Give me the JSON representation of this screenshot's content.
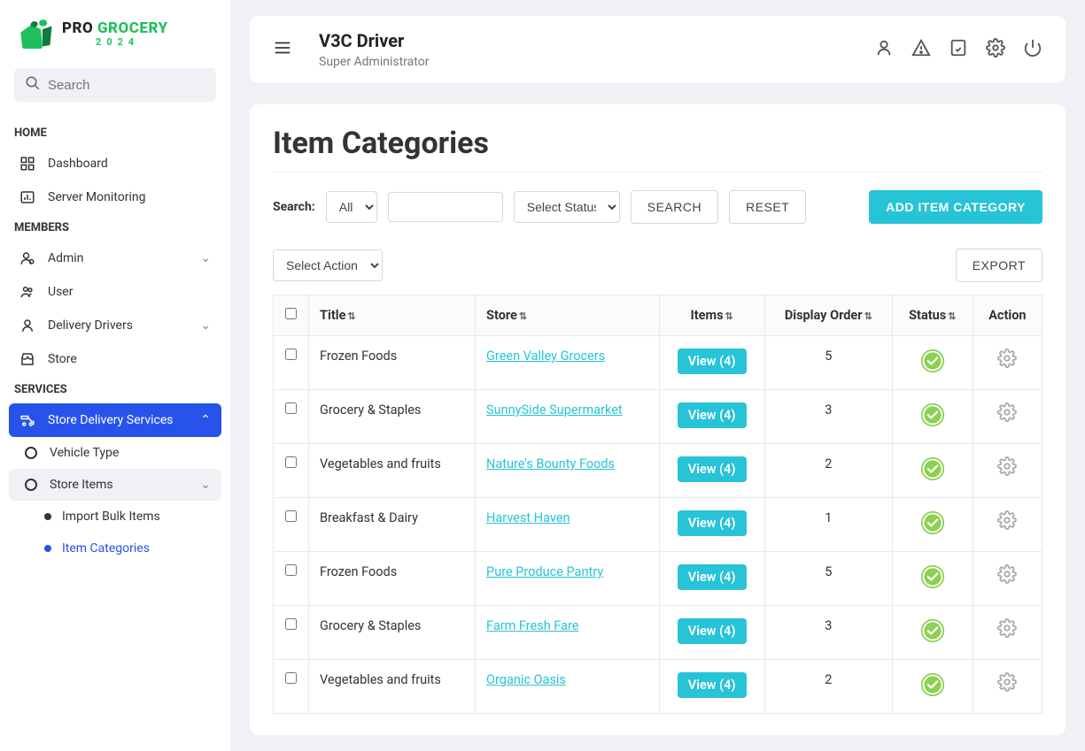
{
  "brand": {
    "pro": "PRO",
    "grocery": "GROCERY",
    "year": "2024"
  },
  "sidebar": {
    "search_placeholder": "Search",
    "sections": {
      "home": "HOME",
      "members": "MEMBERS",
      "services": "SERVICES"
    },
    "home_items": [
      {
        "label": "Dashboard"
      },
      {
        "label": "Server Monitoring"
      }
    ],
    "member_items": [
      {
        "label": "Admin",
        "expandable": true
      },
      {
        "label": "User"
      },
      {
        "label": "Delivery Drivers",
        "expandable": true
      },
      {
        "label": "Store"
      }
    ],
    "services_items": [
      {
        "label": "Store Delivery Services",
        "active": true,
        "expandable": true
      }
    ],
    "delivery_sub": [
      {
        "label": "Vehicle Type"
      },
      {
        "label": "Store Items",
        "sub_active": true,
        "expandable": true
      }
    ],
    "store_items_sub": [
      {
        "label": "Import Bulk Items"
      },
      {
        "label": "Item Categories",
        "current": true
      }
    ]
  },
  "header": {
    "user_name": "V3C Driver",
    "user_role": "Super Administrator"
  },
  "page": {
    "title": "Item Categories",
    "search_label": "Search:",
    "filter_all": "All",
    "select_status": "Select Status",
    "search_btn": "SEARCH",
    "reset_btn": "RESET",
    "add_btn": "ADD ITEM CATEGORY",
    "select_action": "Select Action",
    "export_btn": "EXPORT",
    "columns": {
      "title": "Title",
      "store": "Store",
      "items": "Items",
      "display_order": "Display Order",
      "status": "Status",
      "action": "Action"
    },
    "rows": [
      {
        "title": "Frozen Foods",
        "store": "Green Valley Grocers",
        "items": "View (4)",
        "display_order": "5"
      },
      {
        "title": "Grocery & Staples",
        "store": "SunnySide Supermarket",
        "items": "View (4)",
        "display_order": "3"
      },
      {
        "title": "Vegetables and fruits",
        "store": "Nature's Bounty Foods",
        "items": "View (4)",
        "display_order": "2"
      },
      {
        "title": "Breakfast & Dairy",
        "store": "Harvest Haven",
        "items": "View (4)",
        "display_order": "1"
      },
      {
        "title": "Frozen Foods",
        "store": "Pure Produce Pantry",
        "items": "View (4)",
        "display_order": "5"
      },
      {
        "title": "Grocery & Staples",
        "store": "Farm Fresh Fare",
        "items": "View (4)",
        "display_order": "3"
      },
      {
        "title": "Vegetables and fruits",
        "store": "Organic Oasis",
        "items": "View (4)",
        "display_order": "2"
      }
    ]
  }
}
